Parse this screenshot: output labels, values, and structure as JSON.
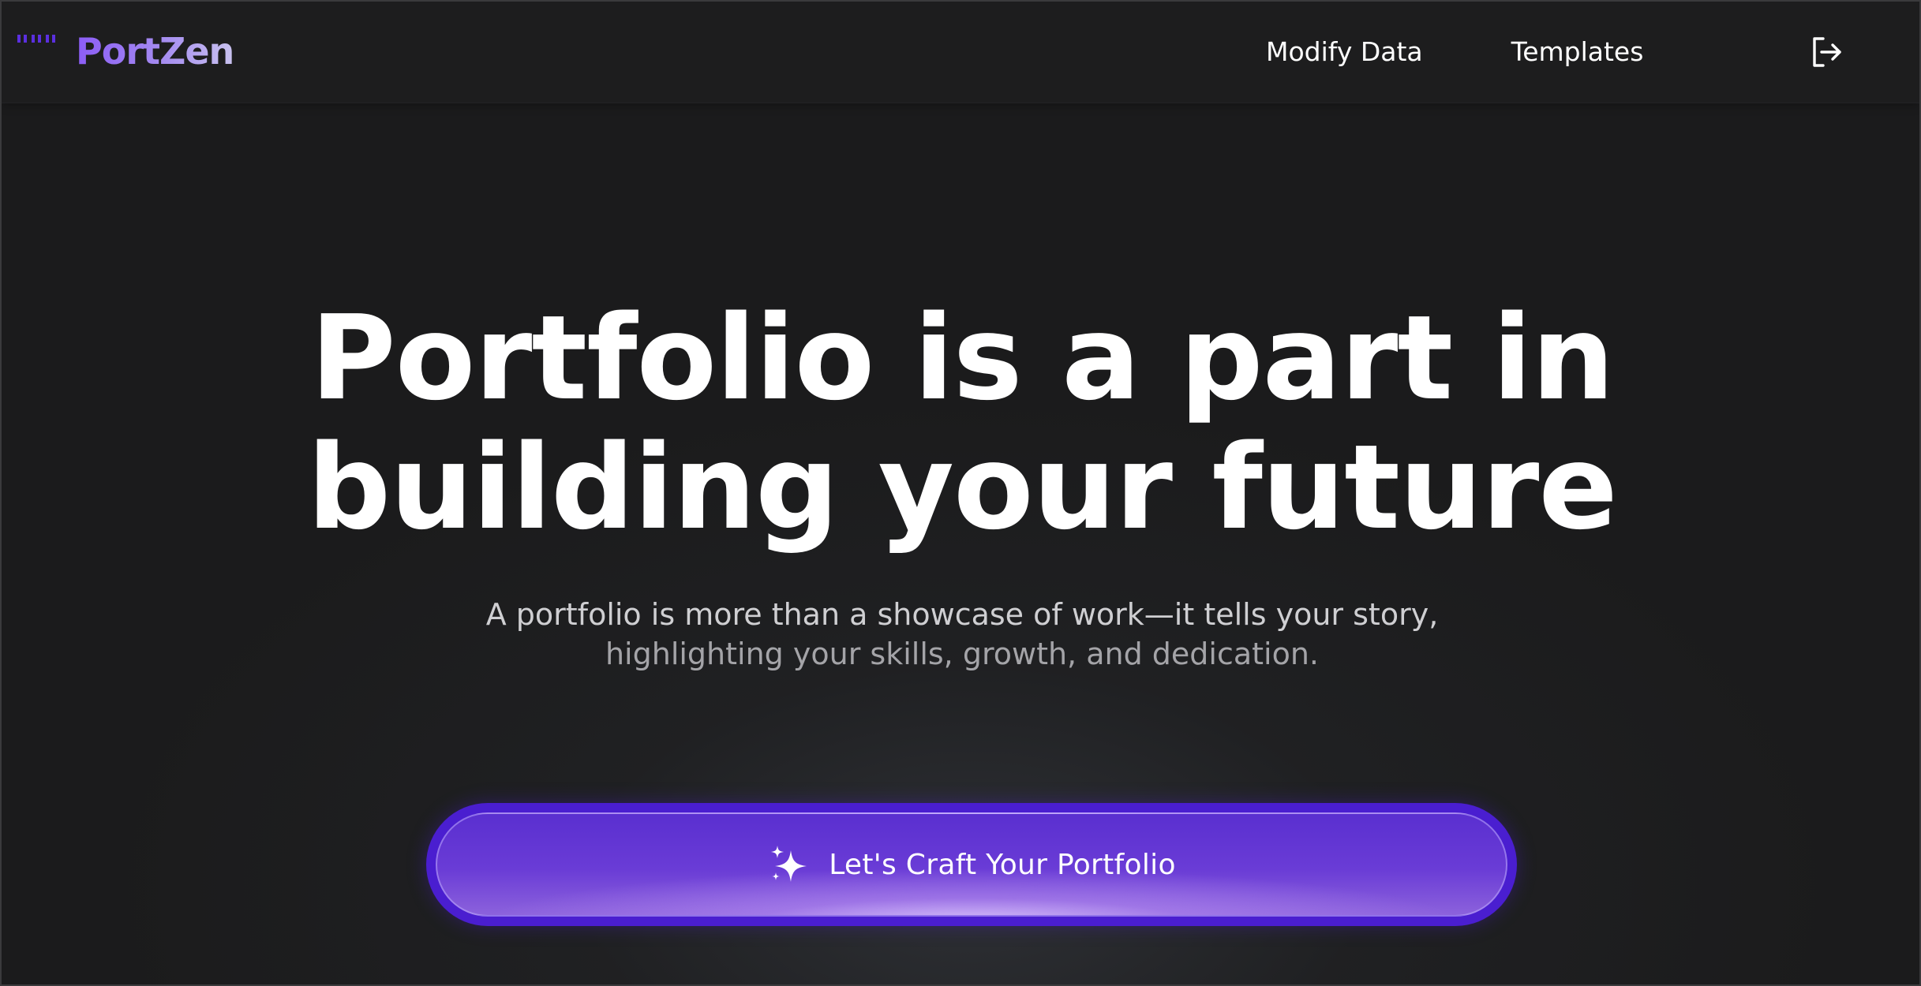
{
  "app": {
    "brand_name": "PortZen"
  },
  "nav": {
    "links": [
      {
        "label": "Modify Data"
      },
      {
        "label": "Templates"
      }
    ],
    "logout_icon": "logout-icon"
  },
  "hero": {
    "title_line1": "Portfolio is a part in",
    "title_line2": "building your future",
    "subtitle_line1": "A portfolio is more than a showcase of work—it tells your story,",
    "subtitle_line2": "highlighting your skills, growth, and dedication."
  },
  "cta": {
    "label": "Let's Craft Your Portfolio",
    "icon": "sparkles-icon"
  },
  "colors": {
    "background": "#1b1b1c",
    "brand_purple": "#8b5cf6",
    "cta_border": "#4a1ed0",
    "cta_fill": "#6a3cd6"
  }
}
